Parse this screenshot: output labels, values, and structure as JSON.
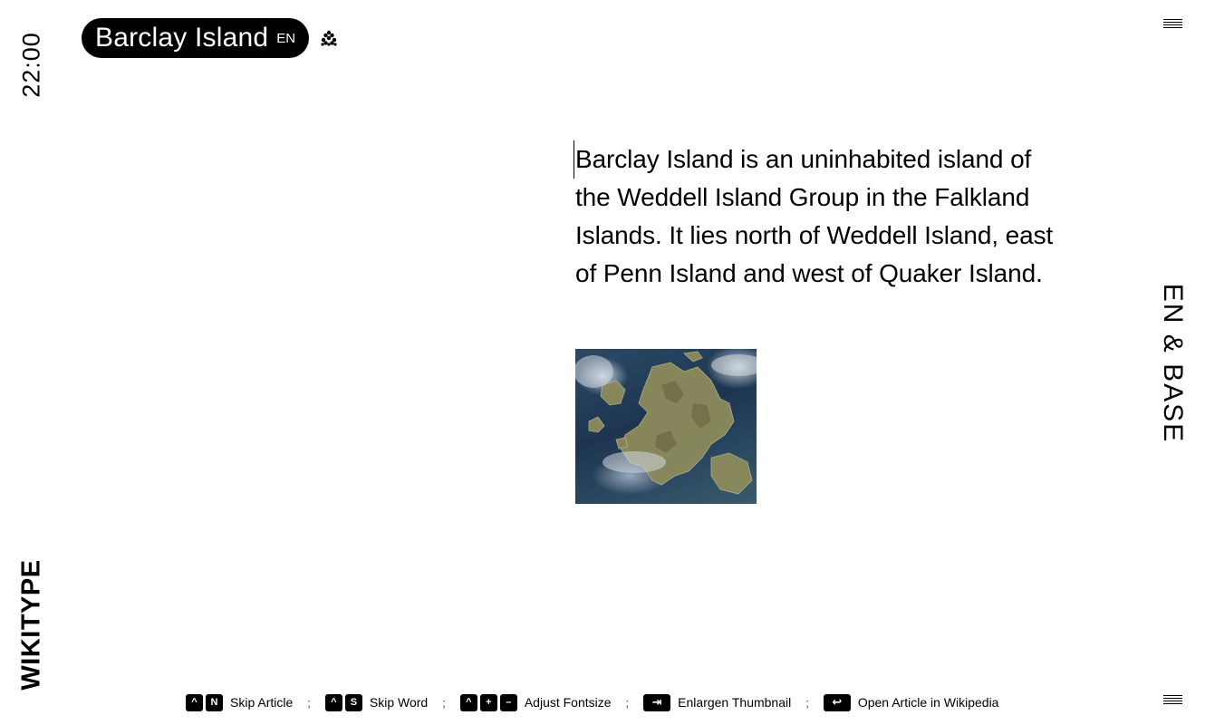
{
  "clock": "22:00",
  "brand": "WIKITYPE",
  "language_mode": "EN & BASE",
  "header": {
    "title": "Barclay Island",
    "lang": "EN",
    "cluster_icon": "cluster-dots-icon",
    "menu_icon": "hamburger-icon"
  },
  "article": {
    "text": "Barclay Island is an uninhabited island of the Weddell Island Group in the Falkland Islands. It lies north of Weddell Island, east of Penn Island and west of Quaker Island.",
    "thumbnail_icon": "satellite-image"
  },
  "shortcuts": [
    {
      "keys": [
        "^",
        "N"
      ],
      "label": "Skip Article"
    },
    {
      "keys": [
        "^",
        "S"
      ],
      "label": "Skip Word"
    },
    {
      "keys": [
        "^",
        "+",
        "–"
      ],
      "label": "Adjust Fontsize"
    },
    {
      "keys": [
        "⇥"
      ],
      "label": "Enlargen Thumbnail"
    },
    {
      "keys": [
        "↩"
      ],
      "label": "Open Article in Wikipedia"
    }
  ],
  "separator": ";"
}
